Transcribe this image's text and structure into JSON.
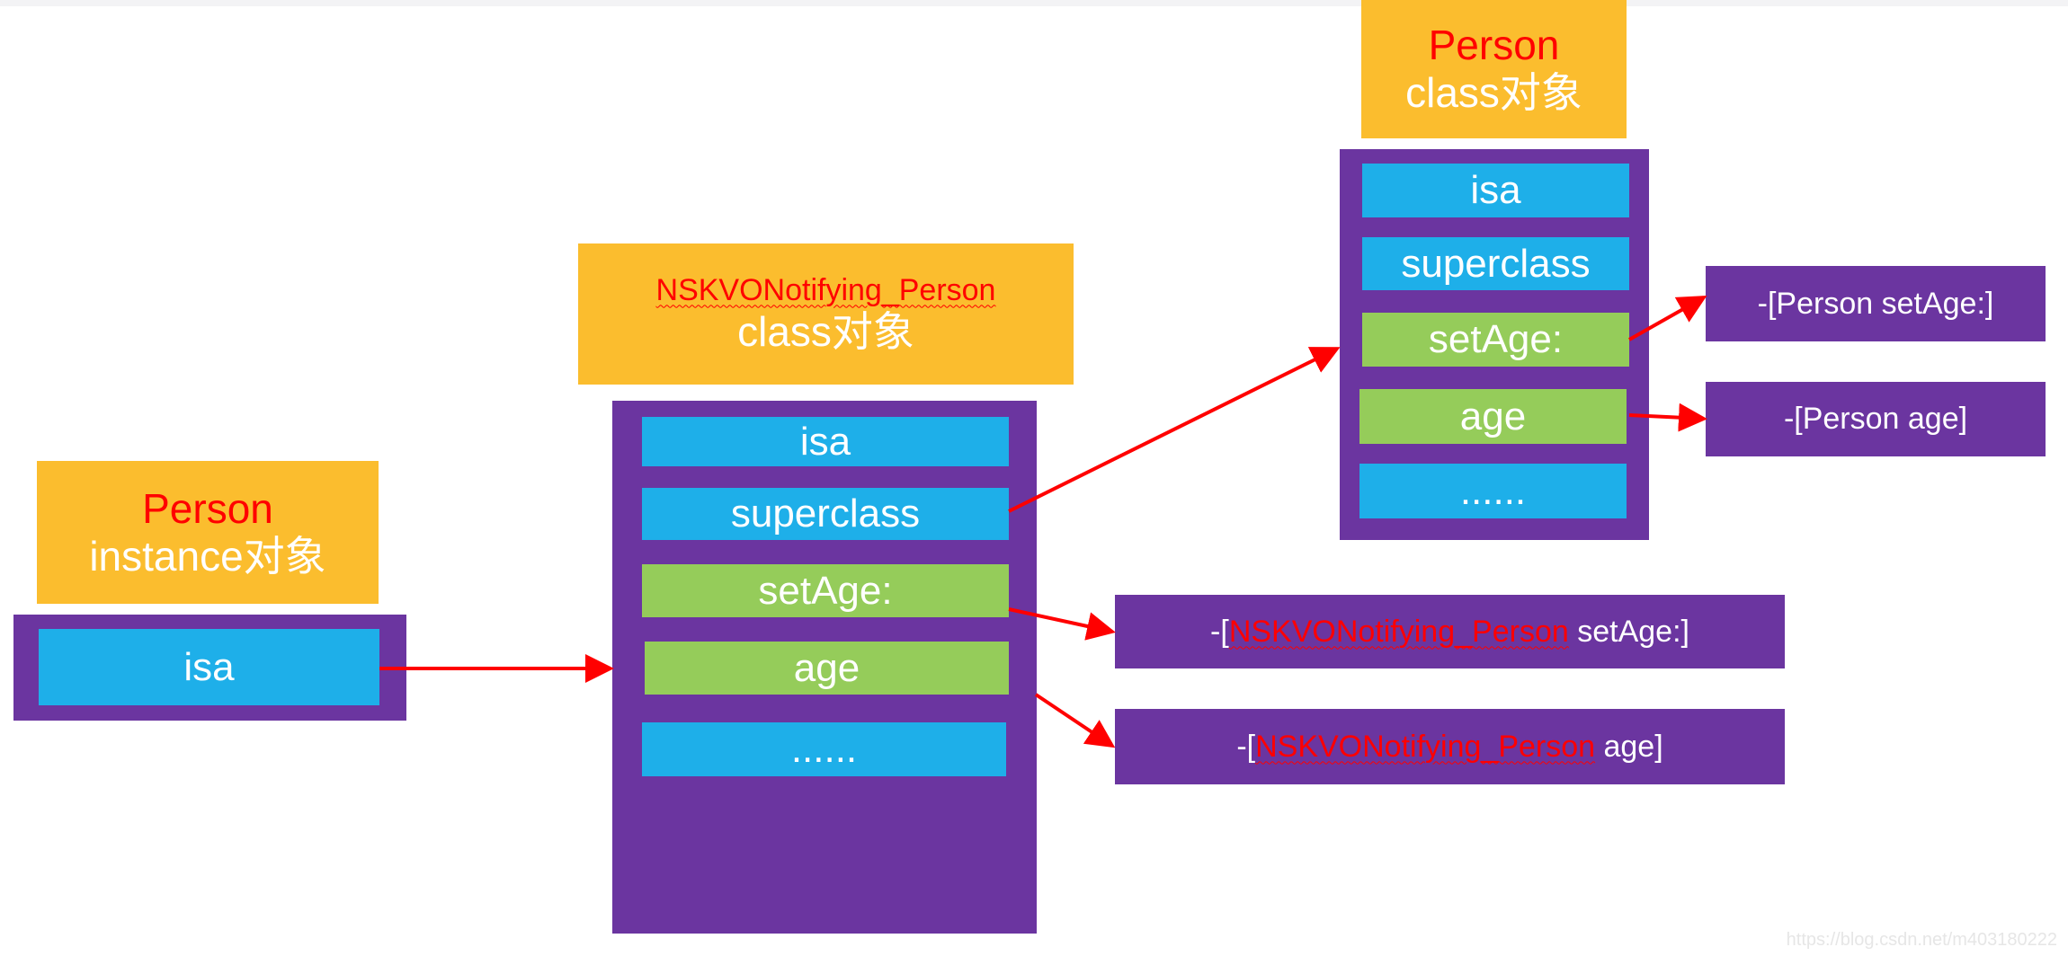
{
  "person_instance": {
    "title": "Person",
    "subtitle": "instance对象",
    "fields": [
      "isa"
    ]
  },
  "kvo_class": {
    "title": "NSKVONotifying_Person",
    "subtitle": "class对象",
    "fields": [
      "isa",
      "superclass",
      "setAge:",
      "age",
      "......"
    ]
  },
  "person_class": {
    "title": "Person",
    "subtitle": "class对象",
    "fields": [
      "isa",
      "superclass",
      "setAge:",
      "age",
      "......"
    ]
  },
  "kvo_methods": [
    {
      "prefix": "-[",
      "class": "NSKVONotifying_Person",
      "selector": " setAge:]"
    },
    {
      "prefix": "-[",
      "class": "NSKVONotifying_Person",
      "selector": " age]"
    }
  ],
  "person_methods": [
    "-[Person setAge:]",
    "-[Person age]"
  ],
  "watermark": "https://blog.csdn.net/m403180222",
  "colors": {
    "header": "#fbbd2e",
    "container": "#6b35a0",
    "pointer_field": "#1eafe9",
    "method_field": "#95cc5a",
    "arrow": "#ff0000",
    "title_text": "#ff0000"
  }
}
